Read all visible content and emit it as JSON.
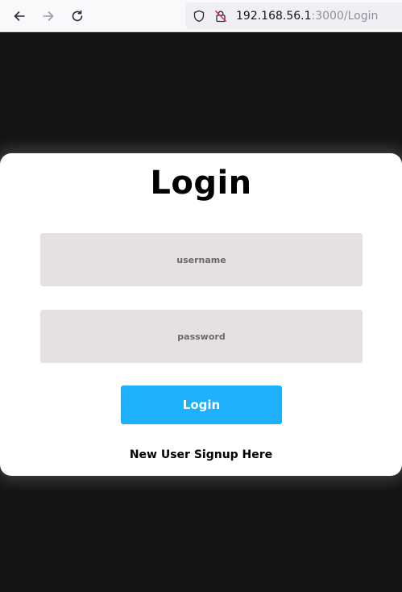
{
  "browser": {
    "url_host": "192.168.56.1",
    "url_rest": ":3000/Login",
    "icons": {
      "back": "arrow-left-icon",
      "forward": "arrow-right-icon",
      "reload": "reload-icon",
      "shield": "shield-icon",
      "insecure_lock": "insecure-lock-icon"
    }
  },
  "login_form": {
    "title": "Login",
    "username_placeholder": "username",
    "password_placeholder": "password",
    "submit_label": "Login",
    "signup_link": "New User Signup Here"
  },
  "colors": {
    "page_background": "#141414",
    "card_background": "#ffffff",
    "input_background": "#e5e1e1",
    "button_background": "#1eb0fb",
    "button_text": "#ffffff"
  }
}
